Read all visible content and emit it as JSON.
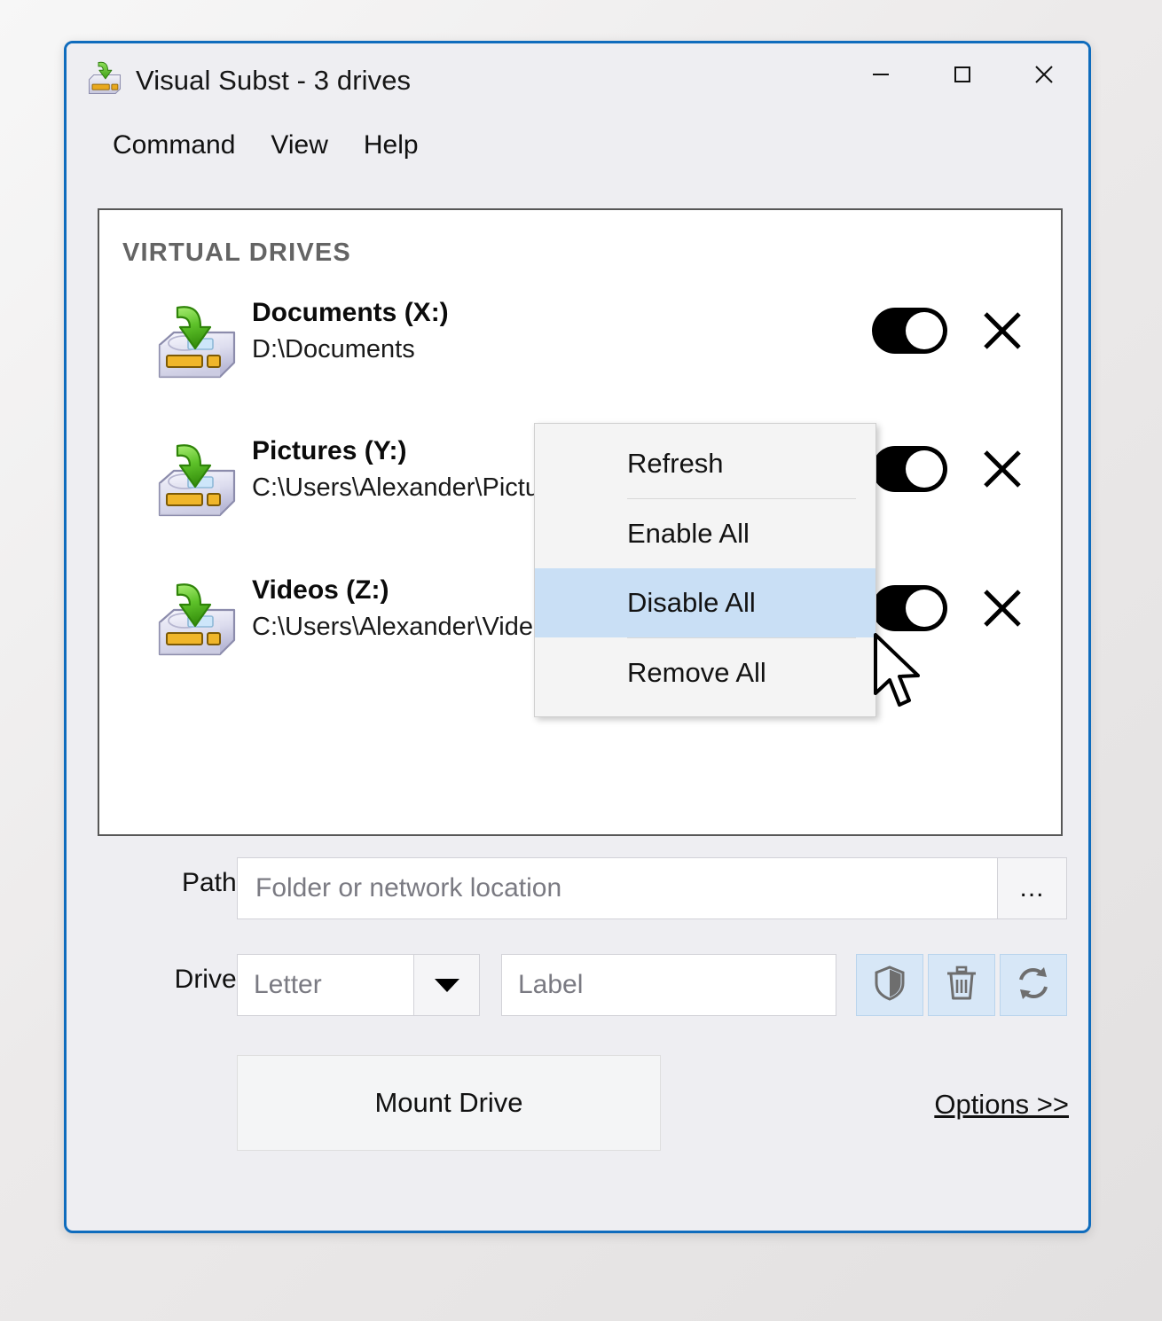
{
  "window": {
    "title": "Visual Subst - 3 drives",
    "app_icon": "virtual-drive-icon",
    "controls": {
      "minimize": "minimize-icon",
      "maximize": "maximize-icon",
      "close": "close-icon"
    },
    "accent_color": "#0f6cbd",
    "background_color": "#eeeef2"
  },
  "menubar": {
    "items": [
      {
        "label": "Command"
      },
      {
        "label": "View"
      },
      {
        "label": "Help"
      }
    ]
  },
  "drive_list": {
    "section_title": "VIRTUAL DRIVES",
    "drives": [
      {
        "name": "Documents (X:)",
        "path": "D:\\Documents",
        "enabled": true,
        "toggle_label": "on",
        "remove_label": "remove"
      },
      {
        "name": "Pictures (Y:)",
        "path": "C:\\Users\\Alexander\\Pictures",
        "enabled": true,
        "toggle_label": "on",
        "remove_label": "remove"
      },
      {
        "name": "Videos (Z:)",
        "path": "C:\\Users\\Alexander\\Videos",
        "enabled": true,
        "toggle_label": "on",
        "remove_label": "remove"
      }
    ]
  },
  "context_menu": {
    "items": [
      {
        "label": "Refresh",
        "selected": false
      },
      {
        "label": "Enable All",
        "selected": false
      },
      {
        "label": "Disable All",
        "selected": true
      },
      {
        "label": "Remove All",
        "selected": false
      }
    ],
    "highlight_color": "#c9dff5"
  },
  "form": {
    "path_label": "Path:",
    "path_value": "",
    "path_placeholder": "Folder or network location",
    "browse_label": "...",
    "drive_label": "Drive:",
    "letter_value": "",
    "letter_placeholder": "Letter",
    "label_value": "",
    "label_placeholder": "Label",
    "action_buttons": [
      {
        "icon": "shield-icon",
        "name": "security-button"
      },
      {
        "icon": "trash-icon",
        "name": "delete-button"
      },
      {
        "icon": "refresh-icon",
        "name": "refresh-button"
      }
    ],
    "mount_label": "Mount Drive",
    "options_label": "Options >>"
  }
}
